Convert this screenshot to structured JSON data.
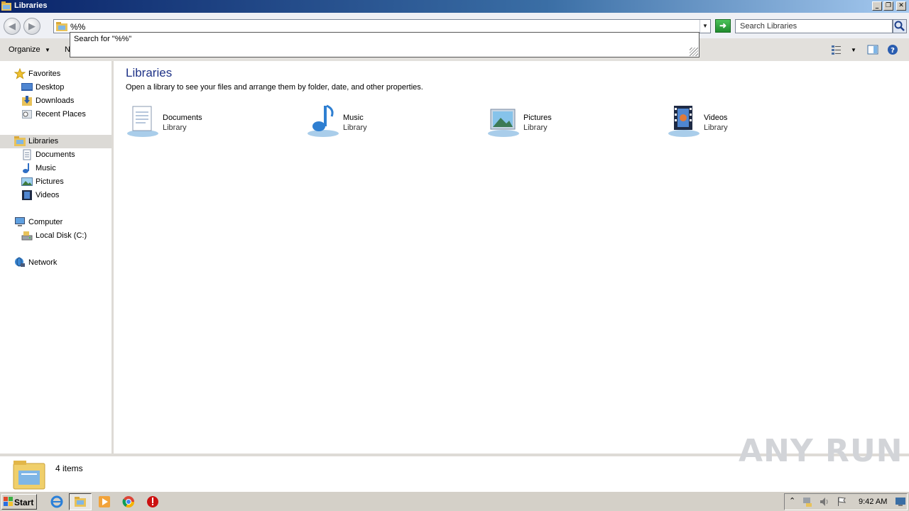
{
  "window": {
    "title": "Libraries",
    "controls": {
      "minimize": "_",
      "restore": "❐",
      "close": "✕"
    }
  },
  "address": {
    "value": "%%",
    "suggestion": "Search for \"%%\""
  },
  "search": {
    "placeholder": "Search Libraries"
  },
  "toolbar": {
    "organize": "Organize",
    "second_cut": "N"
  },
  "nav": {
    "favorites": {
      "label": "Favorites",
      "items": [
        "Desktop",
        "Downloads",
        "Recent Places"
      ]
    },
    "libraries": {
      "label": "Libraries",
      "items": [
        "Documents",
        "Music",
        "Pictures",
        "Videos"
      ]
    },
    "computer": {
      "label": "Computer",
      "items": [
        "Local Disk (C:)"
      ]
    },
    "network": {
      "label": "Network"
    }
  },
  "content": {
    "title": "Libraries",
    "description": "Open a library to see your files and arrange them by folder, date, and other properties.",
    "libraries": [
      {
        "name": "Documents",
        "type": "Library"
      },
      {
        "name": "Music",
        "type": "Library"
      },
      {
        "name": "Pictures",
        "type": "Library"
      },
      {
        "name": "Videos",
        "type": "Library"
      }
    ]
  },
  "details": {
    "count": "4 items"
  },
  "watermark": "ANY RUN",
  "taskbar": {
    "start": "Start",
    "clock": "9:42 AM"
  }
}
